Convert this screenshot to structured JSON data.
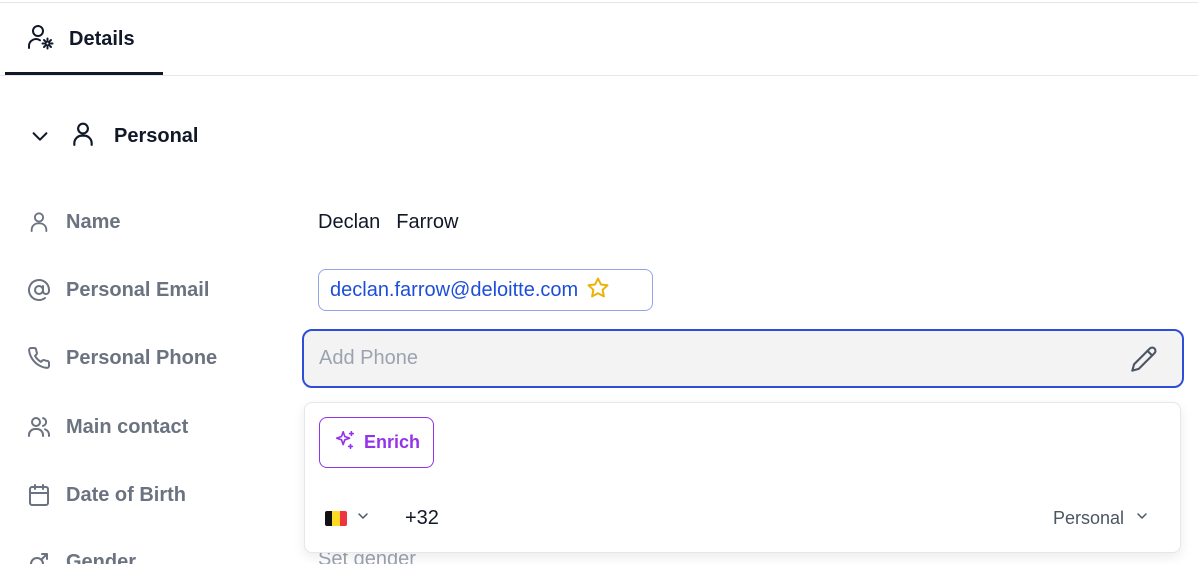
{
  "tabs": [
    {
      "label": "Details",
      "icon": "user-gear-icon",
      "active": true
    }
  ],
  "section": {
    "title": "Personal",
    "expanded": true
  },
  "fields": {
    "name": {
      "label": "Name",
      "first": "Declan",
      "last": "Farrow"
    },
    "personal_email": {
      "label": "Personal Email",
      "value": "declan.farrow@deloitte.com"
    },
    "personal_phone": {
      "label": "Personal Phone",
      "placeholder": "Add Phone",
      "value": ""
    },
    "main_contact": {
      "label": "Main contact"
    },
    "date_of_birth": {
      "label": "Date of Birth"
    },
    "gender": {
      "label": "Gender",
      "placeholder": "Set gender"
    }
  },
  "phone_dropdown": {
    "enrich_label": "Enrich",
    "country": "BE",
    "dial_code": "+32",
    "type": "Personal"
  },
  "colors": {
    "accent": "#2f4ed8",
    "email_link": "#1d4ed8",
    "enrich": "#9333ea",
    "star": "#eab308"
  }
}
